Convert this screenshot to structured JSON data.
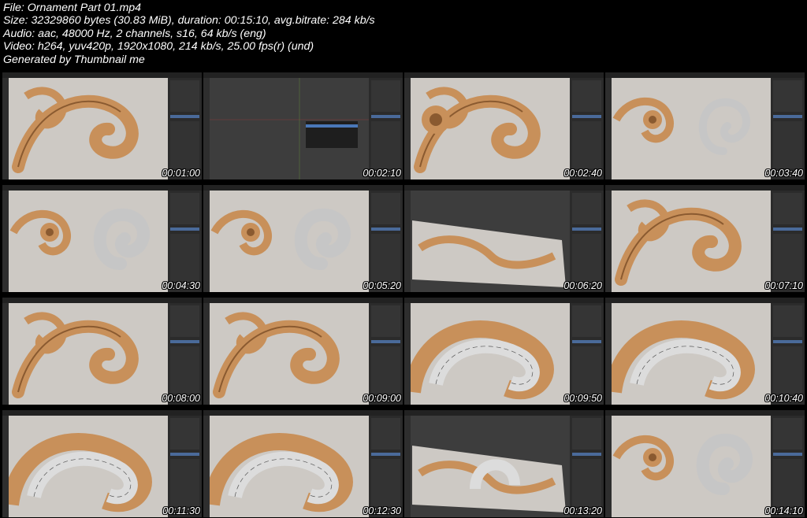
{
  "header": {
    "line1": "File: Ornament Part 01.mp4",
    "line2": "Size: 32329860 bytes (30.83 MiB), duration: 00:15:10, avg.bitrate: 284 kb/s",
    "line3": "Audio: aac, 48000 Hz, 2 channels, s16, 64 kb/s (eng)",
    "line4": "Video: h264, yuv420p, 1920x1080, 214 kb/s, 25.00 fps(r) (und)",
    "line5": "Generated by Thumbnail me"
  },
  "thumbnails": [
    {
      "time": "00:01:00",
      "scene": "scroll"
    },
    {
      "time": "00:02:10",
      "scene": "empty"
    },
    {
      "time": "00:02:40",
      "scene": "flower"
    },
    {
      "time": "00:03:40",
      "scene": "wide-ring"
    },
    {
      "time": "00:04:30",
      "scene": "ring"
    },
    {
      "time": "00:05:20",
      "scene": "ring"
    },
    {
      "time": "00:06:20",
      "scene": "tilted"
    },
    {
      "time": "00:07:10",
      "scene": "scroll"
    },
    {
      "time": "00:08:00",
      "scene": "scroll"
    },
    {
      "time": "00:09:00",
      "scene": "scroll"
    },
    {
      "time": "00:09:50",
      "scene": "mesh"
    },
    {
      "time": "00:10:40",
      "scene": "mesh"
    },
    {
      "time": "00:11:30",
      "scene": "mesh"
    },
    {
      "time": "00:12:30",
      "scene": "mesh"
    },
    {
      "time": "00:13:20",
      "scene": "tilted-mesh"
    },
    {
      "time": "00:14:10",
      "scene": "grey-ring"
    }
  ],
  "colors": {
    "ornament": "#c8905a",
    "ornament_dark": "#8a5a30",
    "ref_bg": "#cdc9c4",
    "viewport": "#3d3d3d",
    "panel": "#2b2b2b"
  }
}
